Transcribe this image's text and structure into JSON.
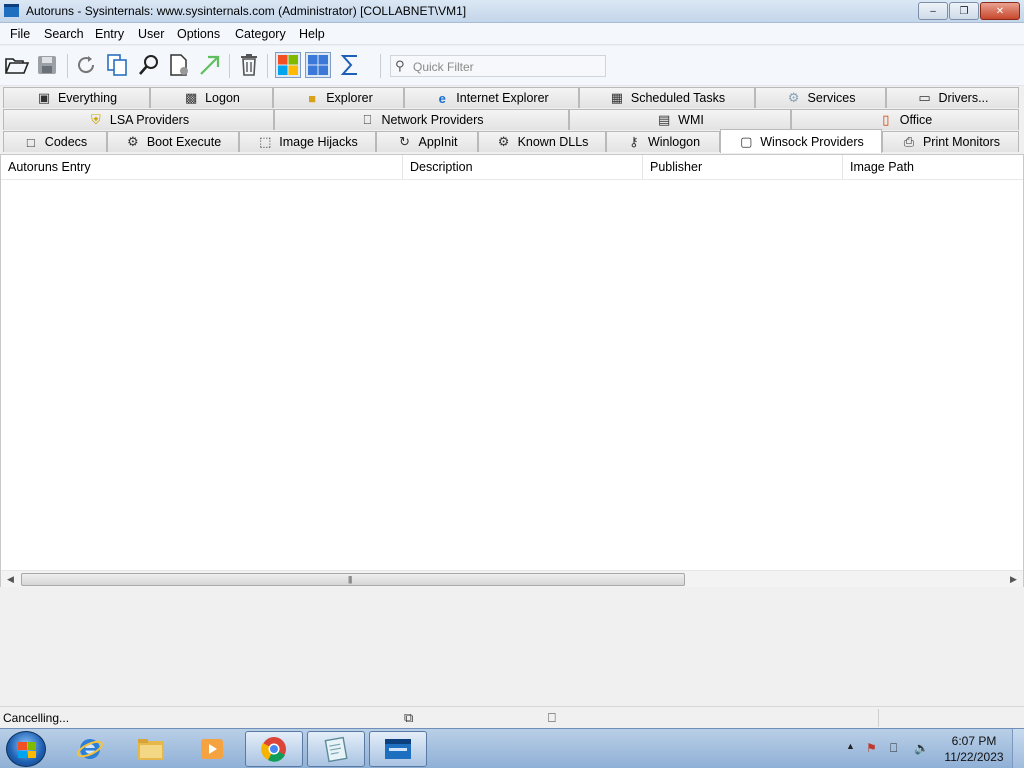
{
  "window": {
    "title": "Autoruns - Sysinternals: www.sysinternals.com (Administrator) [COLLABNET\\VM1]",
    "minimize_glyph": "–",
    "maximize_glyph": "❐",
    "close_glyph": "✕"
  },
  "menu": {
    "items": [
      "File",
      "Search",
      "Entry",
      "User",
      "Options",
      "Category",
      "Help"
    ]
  },
  "toolbar": {
    "icons": [
      "open-icon",
      "save-icon",
      "refresh-icon",
      "copy-icon",
      "find-icon",
      "properties-icon",
      "jump-icon",
      "delete-icon",
      "microsoft-entries-icon",
      "windows-entries-icon",
      "sum-icon"
    ],
    "filter_placeholder": "Quick Filter",
    "filter_value": ""
  },
  "tabs": {
    "row1": [
      "Everything",
      "Logon",
      "Explorer",
      "Internet Explorer",
      "Scheduled Tasks",
      "Services",
      "Drivers..."
    ],
    "row2": [
      "LSA Providers",
      "Network Providers",
      "WMI",
      "Office"
    ],
    "row3": [
      "Codecs",
      "Boot Execute",
      "Image Hijacks",
      "AppInit",
      "Known DLLs",
      "Winlogon",
      "Winsock Providers",
      "Print Monitors"
    ],
    "active": "Winsock Providers"
  },
  "list": {
    "columns": [
      "Autoruns Entry",
      "Description",
      "Publisher",
      "Image Path"
    ],
    "rows": []
  },
  "status": {
    "text": "Cancelling..."
  },
  "taskbar": {
    "apps": [
      "internet-explorer-icon",
      "file-explorer-icon",
      "media-player-icon",
      "chrome-icon",
      "notepad-icon",
      "autoruns-icon"
    ],
    "active_app": "autoruns-icon",
    "time": "6:07 PM",
    "date": "11/22/2023"
  },
  "colors": {
    "titlebar": "#c4d6ea",
    "taskbar": "#8fb0d6",
    "close_button": "#c6472c",
    "active_tab": "#ffffff"
  }
}
